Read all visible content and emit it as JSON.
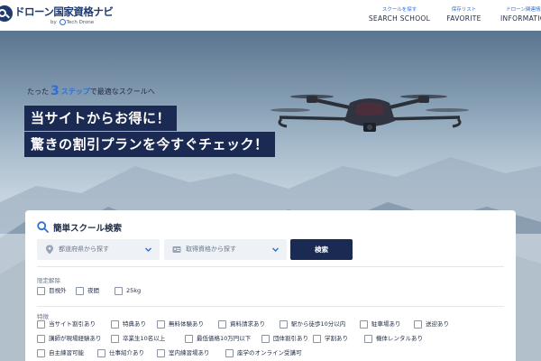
{
  "header": {
    "logo_text": "ドローン国家資格ナビ",
    "logo_by": "by",
    "logo_brand": "Tech Drone",
    "nav": [
      {
        "sub": "スクールを探す",
        "label": "SEARCH SCHOOL"
      },
      {
        "sub": "保存リスト",
        "label": "FAVORITE"
      },
      {
        "sub": "ドローン関連情報",
        "label": "INFORMATION"
      }
    ]
  },
  "hero": {
    "tagline_pre": "たった",
    "tagline_num": "3",
    "tagline_accent": "ステップ",
    "tagline_post": "で最適なスクールへ",
    "line1": "当サイトからお得に！",
    "line2": "驚きの割引プランを今すぐチェック！"
  },
  "search": {
    "title": "簡単スクール検索",
    "prefecture_placeholder": "都道府県から探す",
    "license_placeholder": "取得資格から探す",
    "button_label": "検索",
    "restriction_label": "限定解除",
    "restrictions": [
      "目視外",
      "夜間",
      "25kg"
    ],
    "features_label": "特徴",
    "features_row1": [
      "当サイト割引あり",
      "特典あり",
      "無料体験あり",
      "資料請求あり",
      "駅から徒歩10分以内",
      "駐車場あり",
      "送迎あり"
    ],
    "features_row2": [
      "講師が現場経験あり",
      "卒業生10名以上",
      "最低価格10万円以下",
      "団体割引あり",
      "学割あり",
      "機体レンタルあり"
    ],
    "features_row3": [
      "自主練習可能",
      "仕事紹介あり",
      "室内練習場あり",
      "座学のオンライン受講可"
    ]
  },
  "colors": {
    "navy": "#1b2a52",
    "accent_blue": "#2d6fd6",
    "panel_bg": "#ffffff",
    "select_bg": "#eef1f5"
  }
}
